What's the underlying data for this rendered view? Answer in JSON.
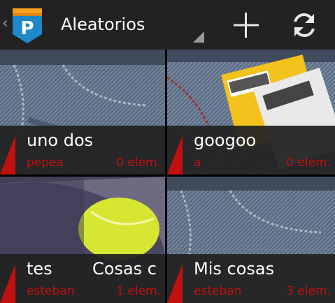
{
  "actionbar": {
    "back_glyph": "‹",
    "logo_letter": "P",
    "title": "Aleatorios",
    "add_icon": "plus-icon",
    "refresh_icon": "refresh-icon"
  },
  "colors": {
    "actionbar_bg": "#222222",
    "accent_red": "#c01010",
    "logo_blue": "#1e88c9",
    "logo_orange": "#f7a21b"
  },
  "lists": [
    {
      "name": "uno dos",
      "owner": "pepea",
      "count": "0 elem.",
      "image": "jeans-pocket"
    },
    {
      "name": "googoo",
      "owner": "a",
      "count": "0 elem.",
      "image": "tickets-in-jeans-pocket"
    },
    {
      "name": "tes",
      "name2": "Cosas c",
      "owner": "esteban",
      "count": "1 elem.",
      "image": "tennis-ball-in-shirt"
    },
    {
      "name": "Mis cosas",
      "owner": "esteban",
      "count": "3 elem.",
      "image": "jeans-pocket"
    }
  ]
}
